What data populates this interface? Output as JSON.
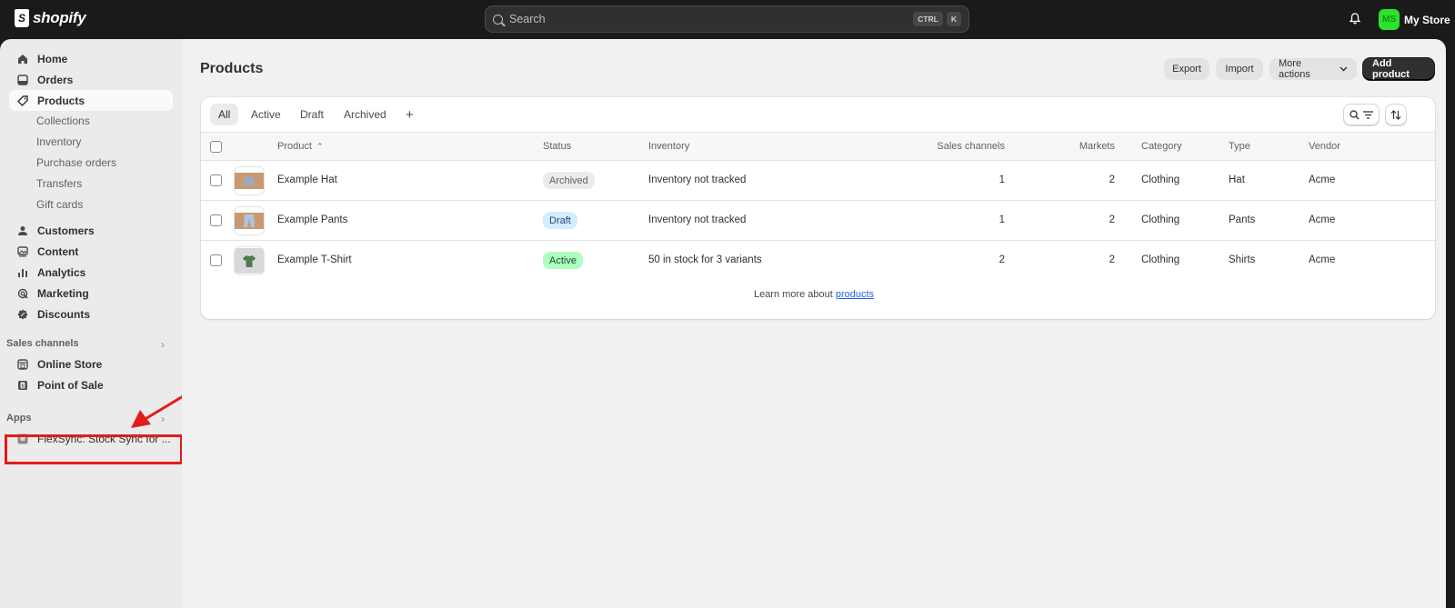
{
  "topbar": {
    "brand": "shopify",
    "search_placeholder": "Search",
    "shortcut_keys": [
      "CTRL",
      "K"
    ],
    "store_initials": "MS",
    "store_name": "My Store",
    "avatar_color": "#2ce22c"
  },
  "sidebar": {
    "main_items": [
      {
        "label": "Home",
        "icon": "home-icon"
      },
      {
        "label": "Orders",
        "icon": "inbox-icon"
      },
      {
        "label": "Products",
        "icon": "tag-icon",
        "active": true
      }
    ],
    "product_subitems": [
      "Collections",
      "Inventory",
      "Purchase orders",
      "Transfers",
      "Gift cards"
    ],
    "more_items": [
      {
        "label": "Customers",
        "icon": "person-icon"
      },
      {
        "label": "Content",
        "icon": "image-icon"
      },
      {
        "label": "Analytics",
        "icon": "bar-chart-icon"
      },
      {
        "label": "Marketing",
        "icon": "target-icon"
      },
      {
        "label": "Discounts",
        "icon": "discount-icon"
      }
    ],
    "sales_channels_label": "Sales channels",
    "sales_channels": [
      {
        "label": "Online Store",
        "icon": "store-icon"
      },
      {
        "label": "Point of Sale",
        "icon": "pos-icon"
      }
    ],
    "apps_label": "Apps",
    "apps": [
      {
        "label": "FlexSync: Stock Sync for ...",
        "icon": "app-icon"
      }
    ],
    "annotation_color": "#e31b1b"
  },
  "main": {
    "title": "Products",
    "actions": {
      "export": "Export",
      "import": "Import",
      "more_actions": "More actions",
      "add_product": "Add product"
    },
    "tabs": [
      "All",
      "Active",
      "Draft",
      "Archived"
    ],
    "add_view_label": "+",
    "columns": {
      "product": "Product",
      "status": "Status",
      "inventory": "Inventory",
      "sales_channels": "Sales channels",
      "markets": "Markets",
      "category": "Category",
      "type": "Type",
      "vendor": "Vendor"
    },
    "rows": [
      {
        "name": "Example Hat",
        "status": "Archived",
        "inventory": "Inventory not tracked",
        "sales_channels": "1",
        "markets": "2",
        "category": "Clothing",
        "type": "Hat",
        "vendor": "Acme"
      },
      {
        "name": "Example Pants",
        "status": "Draft",
        "inventory": "Inventory not tracked",
        "sales_channels": "1",
        "markets": "2",
        "category": "Clothing",
        "type": "Pants",
        "vendor": "Acme"
      },
      {
        "name": "Example T-Shirt",
        "status": "Active",
        "inventory": "50 in stock for 3 variants",
        "sales_channels": "2",
        "markets": "2",
        "category": "Clothing",
        "type": "Shirts",
        "vendor": "Acme"
      }
    ],
    "status_colors": {
      "Archived": {
        "bg": "#ebebeb",
        "fg": "#616161"
      },
      "Draft": {
        "bg": "#d5ebff",
        "fg": "#1e4a7a"
      },
      "Active": {
        "bg": "#affebf",
        "fg": "#0c5132"
      }
    },
    "footer_prefix": "Learn more about ",
    "footer_link": "products"
  }
}
